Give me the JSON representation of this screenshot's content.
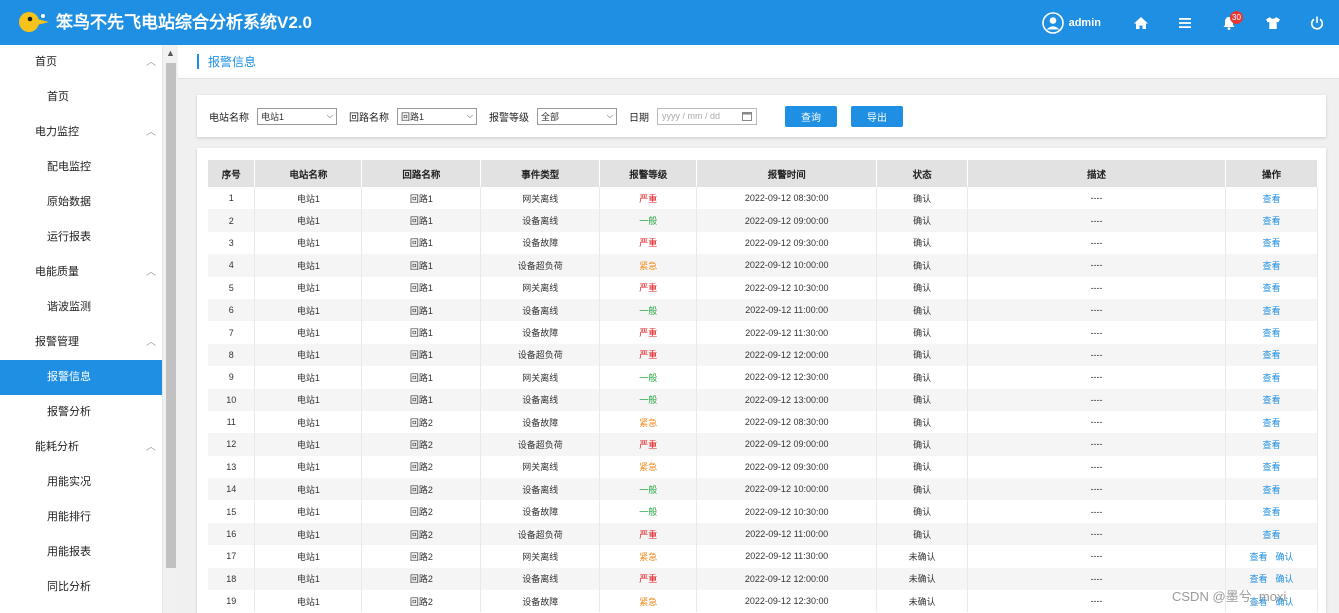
{
  "header": {
    "title": "笨鸟不先飞电站综合分析系统V2.0",
    "username": "admin",
    "notification_count": "30"
  },
  "sidebar": {
    "groups": [
      {
        "label": "首页",
        "items": [
          {
            "label": "首页",
            "active": false
          }
        ]
      },
      {
        "label": "电力监控",
        "items": [
          {
            "label": "配电监控",
            "active": false
          },
          {
            "label": "原始数据",
            "active": false
          },
          {
            "label": "运行报表",
            "active": false
          }
        ]
      },
      {
        "label": "电能质量",
        "items": [
          {
            "label": "谐波监测",
            "active": false
          }
        ]
      },
      {
        "label": "报警管理",
        "items": [
          {
            "label": "报警信息",
            "active": true
          },
          {
            "label": "报警分析",
            "active": false
          }
        ]
      },
      {
        "label": "能耗分析",
        "items": [
          {
            "label": "用能实况",
            "active": false
          },
          {
            "label": "用能排行",
            "active": false
          },
          {
            "label": "用能报表",
            "active": false
          },
          {
            "label": "同比分析",
            "active": false
          }
        ]
      }
    ]
  },
  "breadcrumb": "报警信息",
  "filters": {
    "station_label": "电站名称",
    "station_value": "电站1",
    "loop_label": "回路名称",
    "loop_value": "回路1",
    "level_label": "报警等级",
    "level_value": "全部",
    "date_label": "日期",
    "date_placeholder": "yyyy / mm / dd",
    "query_button": "查询",
    "export_button": "导出"
  },
  "table": {
    "columns": [
      "序号",
      "电站名称",
      "回路名称",
      "事件类型",
      "报警等级",
      "报警时间",
      "状态",
      "描述",
      "操作"
    ],
    "rows": [
      {
        "no": "1",
        "station": "电站1",
        "loop": "回路1",
        "event": "网关离线",
        "level": "严重",
        "time": "2022-09-12 08:30:00",
        "status": "确认",
        "desc": "----",
        "ops": [
          "查看"
        ]
      },
      {
        "no": "2",
        "station": "电站1",
        "loop": "回路1",
        "event": "设备离线",
        "level": "一般",
        "time": "2022-09-12 09:00:00",
        "status": "确认",
        "desc": "----",
        "ops": [
          "查看"
        ]
      },
      {
        "no": "3",
        "station": "电站1",
        "loop": "回路1",
        "event": "设备故障",
        "level": "严重",
        "time": "2022-09-12 09:30:00",
        "status": "确认",
        "desc": "----",
        "ops": [
          "查看"
        ]
      },
      {
        "no": "4",
        "station": "电站1",
        "loop": "回路1",
        "event": "设备超负荷",
        "level": "紧急",
        "time": "2022-09-12 10:00:00",
        "status": "确认",
        "desc": "----",
        "ops": [
          "查看"
        ]
      },
      {
        "no": "5",
        "station": "电站1",
        "loop": "回路1",
        "event": "网关离线",
        "level": "严重",
        "time": "2022-09-12 10:30:00",
        "status": "确认",
        "desc": "----",
        "ops": [
          "查看"
        ]
      },
      {
        "no": "6",
        "station": "电站1",
        "loop": "回路1",
        "event": "设备离线",
        "level": "一般",
        "time": "2022-09-12 11:00:00",
        "status": "确认",
        "desc": "----",
        "ops": [
          "查看"
        ]
      },
      {
        "no": "7",
        "station": "电站1",
        "loop": "回路1",
        "event": "设备故障",
        "level": "严重",
        "time": "2022-09-12 11:30:00",
        "status": "确认",
        "desc": "----",
        "ops": [
          "查看"
        ]
      },
      {
        "no": "8",
        "station": "电站1",
        "loop": "回路1",
        "event": "设备超负荷",
        "level": "严重",
        "time": "2022-09-12 12:00:00",
        "status": "确认",
        "desc": "----",
        "ops": [
          "查看"
        ]
      },
      {
        "no": "9",
        "station": "电站1",
        "loop": "回路1",
        "event": "网关离线",
        "level": "一般",
        "time": "2022-09-12 12:30:00",
        "status": "确认",
        "desc": "----",
        "ops": [
          "查看"
        ]
      },
      {
        "no": "10",
        "station": "电站1",
        "loop": "回路1",
        "event": "设备离线",
        "level": "一般",
        "time": "2022-09-12 13:00:00",
        "status": "确认",
        "desc": "----",
        "ops": [
          "查看"
        ]
      },
      {
        "no": "11",
        "station": "电站1",
        "loop": "回路2",
        "event": "设备故障",
        "level": "紧急",
        "time": "2022-09-12 08:30:00",
        "status": "确认",
        "desc": "----",
        "ops": [
          "查看"
        ]
      },
      {
        "no": "12",
        "station": "电站1",
        "loop": "回路2",
        "event": "设备超负荷",
        "level": "严重",
        "time": "2022-09-12 09:00:00",
        "status": "确认",
        "desc": "----",
        "ops": [
          "查看"
        ]
      },
      {
        "no": "13",
        "station": "电站1",
        "loop": "回路2",
        "event": "网关离线",
        "level": "紧急",
        "time": "2022-09-12 09:30:00",
        "status": "确认",
        "desc": "----",
        "ops": [
          "查看"
        ]
      },
      {
        "no": "14",
        "station": "电站1",
        "loop": "回路2",
        "event": "设备离线",
        "level": "一般",
        "time": "2022-09-12 10:00:00",
        "status": "确认",
        "desc": "----",
        "ops": [
          "查看"
        ]
      },
      {
        "no": "15",
        "station": "电站1",
        "loop": "回路2",
        "event": "设备故障",
        "level": "一般",
        "time": "2022-09-12 10:30:00",
        "status": "确认",
        "desc": "----",
        "ops": [
          "查看"
        ]
      },
      {
        "no": "16",
        "station": "电站1",
        "loop": "回路2",
        "event": "设备超负荷",
        "level": "严重",
        "time": "2022-09-12 11:00:00",
        "status": "确认",
        "desc": "----",
        "ops": [
          "查看"
        ]
      },
      {
        "no": "17",
        "station": "电站1",
        "loop": "回路2",
        "event": "网关离线",
        "level": "紧急",
        "time": "2022-09-12 11:30:00",
        "status": "未确认",
        "desc": "----",
        "ops": [
          "查看",
          "确认"
        ]
      },
      {
        "no": "18",
        "station": "电站1",
        "loop": "回路2",
        "event": "设备离线",
        "level": "严重",
        "time": "2022-09-12 12:00:00",
        "status": "未确认",
        "desc": "----",
        "ops": [
          "查看",
          "确认"
        ]
      },
      {
        "no": "19",
        "station": "电站1",
        "loop": "回路2",
        "event": "设备故障",
        "level": "紧急",
        "time": "2022-09-12 12:30:00",
        "status": "未确认",
        "desc": "----",
        "ops": [
          "查看",
          "确认"
        ]
      }
    ]
  },
  "watermark": "CSDN @墨兮_moxi",
  "colors": {
    "primary": "#1e8fe3",
    "level_severe": "#e0191b",
    "level_normal": "#28a745",
    "level_urgent": "#f28a1b"
  }
}
